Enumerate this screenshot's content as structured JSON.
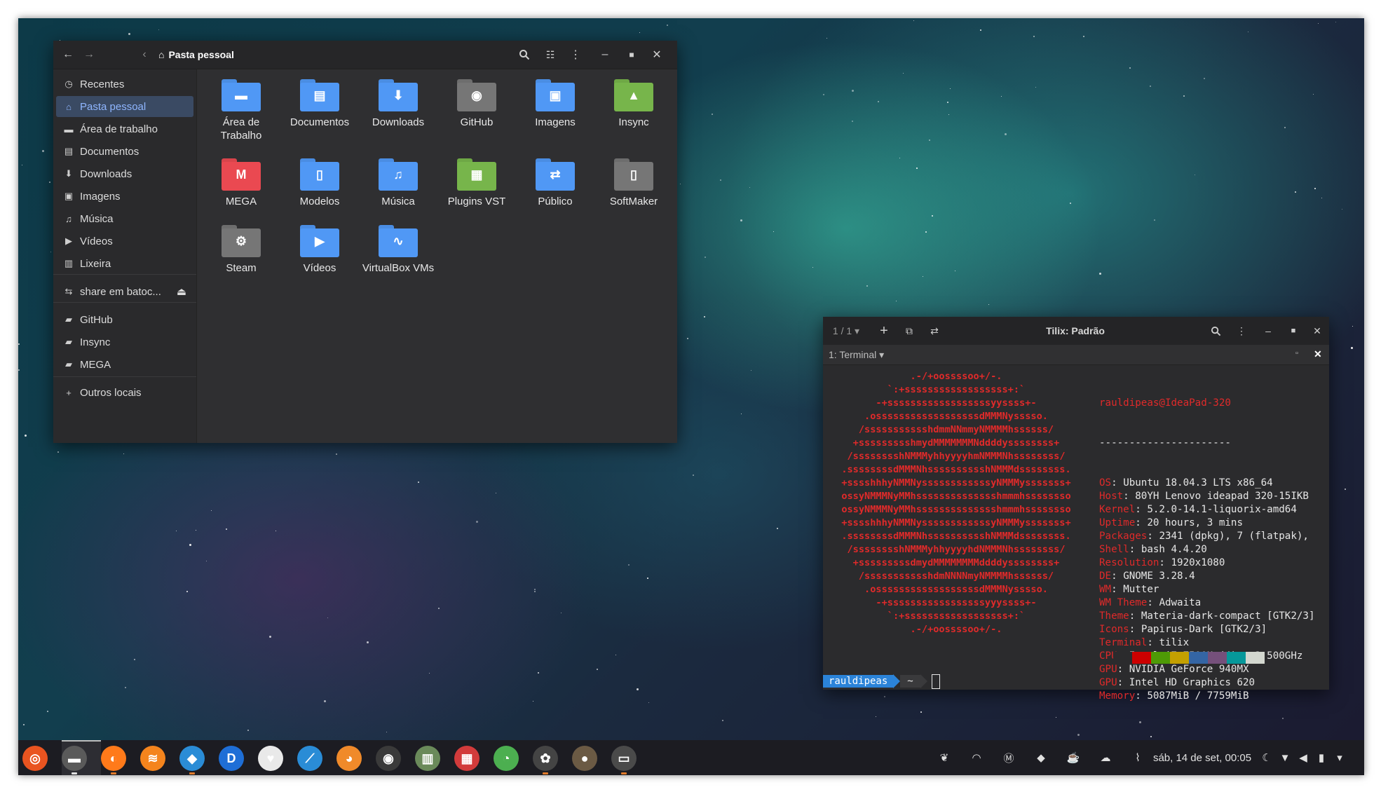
{
  "file_manager": {
    "title": "Pasta pessoal",
    "sidebar": [
      {
        "label": "Recentes",
        "icon": "clock-icon"
      },
      {
        "label": "Pasta pessoal",
        "icon": "home-icon",
        "active": true
      },
      {
        "label": "Área de trabalho",
        "icon": "desktop-icon"
      },
      {
        "label": "Documentos",
        "icon": "document-icon"
      },
      {
        "label": "Downloads",
        "icon": "download-icon"
      },
      {
        "label": "Imagens",
        "icon": "image-icon"
      },
      {
        "label": "Música",
        "icon": "music-icon"
      },
      {
        "label": "Vídeos",
        "icon": "video-icon"
      },
      {
        "label": "Lixeira",
        "icon": "trash-icon"
      },
      {
        "label": "share em batoc...",
        "icon": "network-icon"
      },
      {
        "label": "GitHub",
        "icon": "folder-icon"
      },
      {
        "label": "Insync",
        "icon": "folder-icon"
      },
      {
        "label": "MEGA",
        "icon": "folder-icon"
      },
      {
        "label": "Outros locais",
        "icon": "plus-icon"
      }
    ],
    "items": [
      {
        "label": "Área de Trabalho",
        "color": "#4a8de3",
        "glyph": "▬"
      },
      {
        "label": "Documentos",
        "color": "#4a8de3",
        "glyph": "▤"
      },
      {
        "label": "Downloads",
        "color": "#4a8de3",
        "glyph": "⬇"
      },
      {
        "label": "GitHub",
        "color": "#6d6d6d",
        "glyph": "◉"
      },
      {
        "label": "Imagens",
        "color": "#4a8de3",
        "glyph": "▣"
      },
      {
        "label": "Insync",
        "color": "#6ea845",
        "glyph": "▲"
      },
      {
        "label": "MEGA",
        "color": "#d9444b",
        "glyph": "M"
      },
      {
        "label": "Modelos",
        "color": "#4a8de3",
        "glyph": "▯"
      },
      {
        "label": "Música",
        "color": "#4a8de3",
        "glyph": "♫"
      },
      {
        "label": "Plugins VST",
        "color": "#6ea845",
        "glyph": "▦"
      },
      {
        "label": "Público",
        "color": "#4a8de3",
        "glyph": "⇄"
      },
      {
        "label": "SoftMaker",
        "color": "#6d6d6d",
        "glyph": "▯"
      },
      {
        "label": "Steam",
        "color": "#6d6d6d",
        "glyph": "⚙"
      },
      {
        "label": "Vídeos",
        "color": "#4a8de3",
        "glyph": "▶"
      },
      {
        "label": "VirtualBox VMs",
        "color": "#4a8de3",
        "glyph": "∿"
      }
    ]
  },
  "terminal": {
    "tab_counter": "1 / 1",
    "title": "Tilix: Padrão",
    "sub_title": "1: Terminal",
    "ascii": [
      ".-/+oossssoo+/-.",
      "`:+ssssssssssssssssss+:`",
      "-+ssssssssssssssssssyyssss+-",
      ".ossssssssssssssssssdMMMNysssso.",
      "/ssssssssssshdmmNNmmyNMMMMhssssss/",
      "+ssssssssshmydMMMMMMMNddddyssssssss+",
      "/sssssssshNMMMyhhyyyyhmNMMMNhssssssss/",
      ".ssssssssdMMMNhsssssssssshNMMMdssssssss.",
      "+sssshhhyNMMNyssssssssssssyNMMMysssssss+",
      "ossyNMMMNyMMhsssssssssssssshmmmhssssssso",
      "ossyNMMMNyMMhsssssssssssssshmmmhssssssso",
      "+sssshhhyNMMNyssssssssssssyNMMMysssssss+",
      ".ssssssssdMMMNhsssssssssshNMMMdssssssss.",
      "/sssssssshNMMMyhhyyyyhdNMMMNhssssssss/",
      "+sssssssssdmydMMMMMMMMddddyssssssss+",
      "/ssssssssssshdmNNNNmyNMMMMhssssss/",
      ".ossssssssssssssssssdMMMNysssso.",
      "-+sssssssssssssssssyyyssss+-",
      "`:+ssssssssssssssssss+:`",
      ".-/+oossssoo+/-."
    ],
    "user_host": "rauldipeas@IdeaPad-320",
    "user": "rauldipeas",
    "at_host": "@IdeaPad-320",
    "separator": "----------------------",
    "info": [
      {
        "k": "OS",
        "v": "Ubuntu 18.04.3 LTS x86_64"
      },
      {
        "k": "Host",
        "v": "80YH Lenovo ideapad 320-15IKB"
      },
      {
        "k": "Kernel",
        "v": "5.2.0-14.1-liquorix-amd64"
      },
      {
        "k": "Uptime",
        "v": "20 hours, 3 mins"
      },
      {
        "k": "Packages",
        "v": "2341 (dpkg), 7 (flatpak),"
      },
      {
        "k": "Shell",
        "v": "bash 4.4.20"
      },
      {
        "k": "Resolution",
        "v": "1920x1080"
      },
      {
        "k": "DE",
        "v": "GNOME 3.28.4"
      },
      {
        "k": "WM",
        "v": "Mutter"
      },
      {
        "k": "WM Theme",
        "v": "Adwaita"
      },
      {
        "k": "Theme",
        "v": "Materia-dark-compact [GTK2/3]"
      },
      {
        "k": "Icons",
        "v": "Papirus-Dark [GTK2/3]"
      },
      {
        "k": "Terminal",
        "v": "tilix"
      },
      {
        "k": "CPU",
        "v": "Intel i7-7500U (4) @ 3.500GHz"
      },
      {
        "k": "GPU",
        "v": "NVIDIA GeForce 940MX"
      },
      {
        "k": "GPU",
        "v": "Intel HD Graphics 620"
      },
      {
        "k": "Memory",
        "v": "5087MiB / 7759MiB"
      }
    ],
    "swatch_colors": [
      "#2b2b2d",
      "#cc0000",
      "#4e9a06",
      "#c4a000",
      "#3465a4",
      "#75507b",
      "#06989a",
      "#d3d7cf"
    ],
    "prompt_user": "rauldipeas",
    "prompt_dir": "~"
  },
  "taskbar": {
    "apps": [
      {
        "name": "ubuntu-icon",
        "color": "#e95420",
        "glyph": "◎"
      },
      {
        "name": "files-icon",
        "color": "#5a5a5a",
        "glyph": "▬"
      },
      {
        "name": "firefox-icon",
        "color": "#ff7a1a",
        "glyph": "◐"
      },
      {
        "name": "rss-icon",
        "color": "#f4841d",
        "glyph": "≋"
      },
      {
        "name": "mailspring-icon",
        "color": "#2a8cd6",
        "glyph": "◆"
      },
      {
        "name": "deezer-icon",
        "color": "#1e6ed6",
        "glyph": "D"
      },
      {
        "name": "solitaire-icon",
        "color": "#e9e9e9",
        "glyph": "♥"
      },
      {
        "name": "steam-link-icon",
        "color": "#2a8cd6",
        "glyph": "⟋"
      },
      {
        "name": "cartridge-icon",
        "color": "#f08a2a",
        "glyph": "◕"
      },
      {
        "name": "obs-icon",
        "color": "#3a3a3a",
        "glyph": "◉"
      },
      {
        "name": "glade-icon",
        "color": "#6a8a5a",
        "glyph": "▥"
      },
      {
        "name": "mixer-icon",
        "color": "#d23b3b",
        "glyph": "▦"
      },
      {
        "name": "chrome-icon",
        "color": "#4caf50",
        "glyph": "◔"
      },
      {
        "name": "resolve-icon",
        "color": "#444",
        "glyph": "✿"
      },
      {
        "name": "gimp-icon",
        "color": "#6b5a44",
        "glyph": "●"
      },
      {
        "name": "terminal-icon",
        "color": "#4a4a4a",
        "glyph": "▭"
      }
    ],
    "tray_icons": [
      "leaf-icon",
      "wifi-signal-icon",
      "mega-tray-icon",
      "drop-icon",
      "coffee-icon",
      "insync-tray-icon",
      "paperclip-icon"
    ],
    "clock": "sáb, 14 de set, 00:05",
    "system_icons": [
      "night-icon",
      "network-icon",
      "volume-icon",
      "battery-icon",
      "menu-arrow-icon"
    ]
  }
}
